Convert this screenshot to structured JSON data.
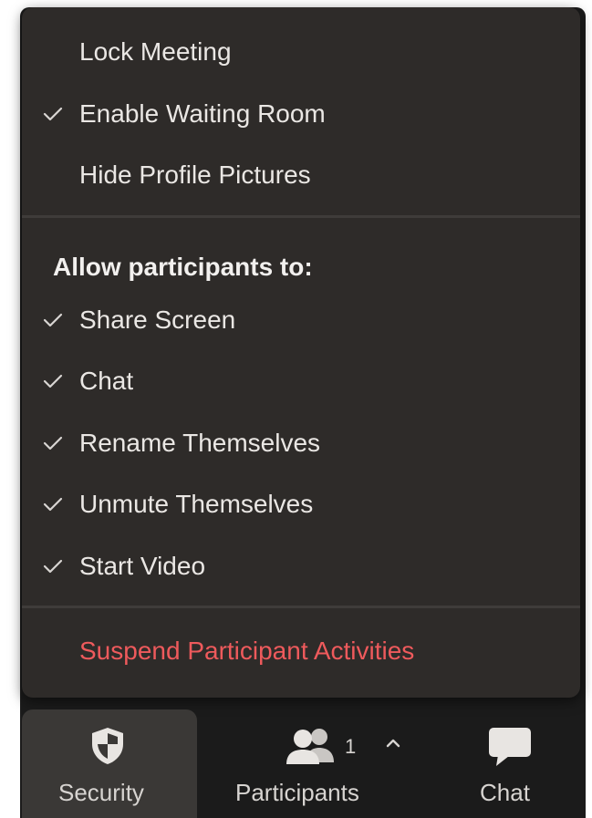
{
  "menu": {
    "items_top": [
      {
        "label": "Lock Meeting",
        "checked": false
      },
      {
        "label": "Enable Waiting Room",
        "checked": true
      },
      {
        "label": "Hide Profile Pictures",
        "checked": false
      }
    ],
    "section_title": "Allow participants to:",
    "permissions": [
      {
        "label": "Share Screen",
        "checked": true
      },
      {
        "label": "Chat",
        "checked": true
      },
      {
        "label": "Rename Themselves",
        "checked": true
      },
      {
        "label": "Unmute Themselves",
        "checked": true
      },
      {
        "label": "Start Video",
        "checked": true
      }
    ],
    "suspend_label": "Suspend Participant Activities"
  },
  "toolbar": {
    "security": {
      "label": "Security",
      "icon": "shield-icon",
      "active": true
    },
    "participants": {
      "label": "Participants",
      "icon": "participants-icon",
      "count": "1",
      "caret_icon": "chevron-up-icon"
    },
    "chat": {
      "label": "Chat",
      "icon": "chat-bubble-icon"
    }
  },
  "colors": {
    "menu_bg": "#2e2b29",
    "text": "#eae7e4",
    "danger": "#ee5a5c",
    "toolbar_bg": "#1b1b1b",
    "active_tab": "#3a3836"
  }
}
